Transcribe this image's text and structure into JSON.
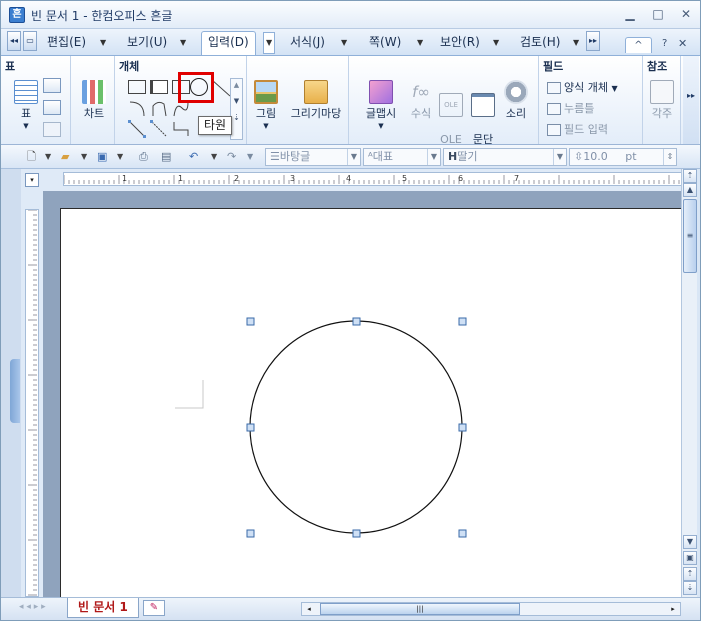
{
  "titlebar": {
    "app_icon": "page-icon",
    "title": "빈 문서 1 - 한컴오피스 흔글"
  },
  "menu": {
    "tabs": [
      {
        "label": "편집(E)"
      },
      {
        "label": "보기(U)"
      },
      {
        "label": "입력(D)"
      },
      {
        "label": "서식(J)"
      },
      {
        "label": "쪽(W)"
      },
      {
        "label": "보안(R)"
      },
      {
        "label": "검토(H)"
      }
    ],
    "help_icons": [
      "^",
      "?",
      "×"
    ]
  },
  "ribbon": {
    "groups": {
      "table": {
        "title": "표",
        "label": "표"
      },
      "chart": {
        "label": "차트"
      },
      "object": {
        "title": "개체"
      },
      "picture": {
        "label": "그림"
      },
      "drawmadang": {
        "label": "그리기마당"
      },
      "glmap": {
        "label": "글맵시"
      },
      "formula": {
        "label": "수식"
      },
      "ole": {
        "label": "OLE\n개체"
      },
      "paragraph": {
        "label": "문단\n[I]"
      },
      "sound": {
        "label": "소리"
      },
      "field": {
        "title": "필드",
        "form_object": "양식 개체",
        "button": "누름틀",
        "field_input": "필드 입력"
      },
      "reference": {
        "title": "참조",
        "footnote": "각주"
      }
    }
  },
  "tooltip": {
    "text": "타원"
  },
  "toolbar": {
    "style_combo": "바탕글",
    "font_lang_combo": "대표",
    "font_combo": "딸기",
    "size_combo": "10.0",
    "size_unit": "pt"
  },
  "ruler": {
    "h_ticks": [
      "1",
      "1",
      "2",
      "3",
      "4",
      "5",
      "6",
      "7"
    ]
  },
  "status": {
    "doc_tab": "빈 문서 1"
  }
}
